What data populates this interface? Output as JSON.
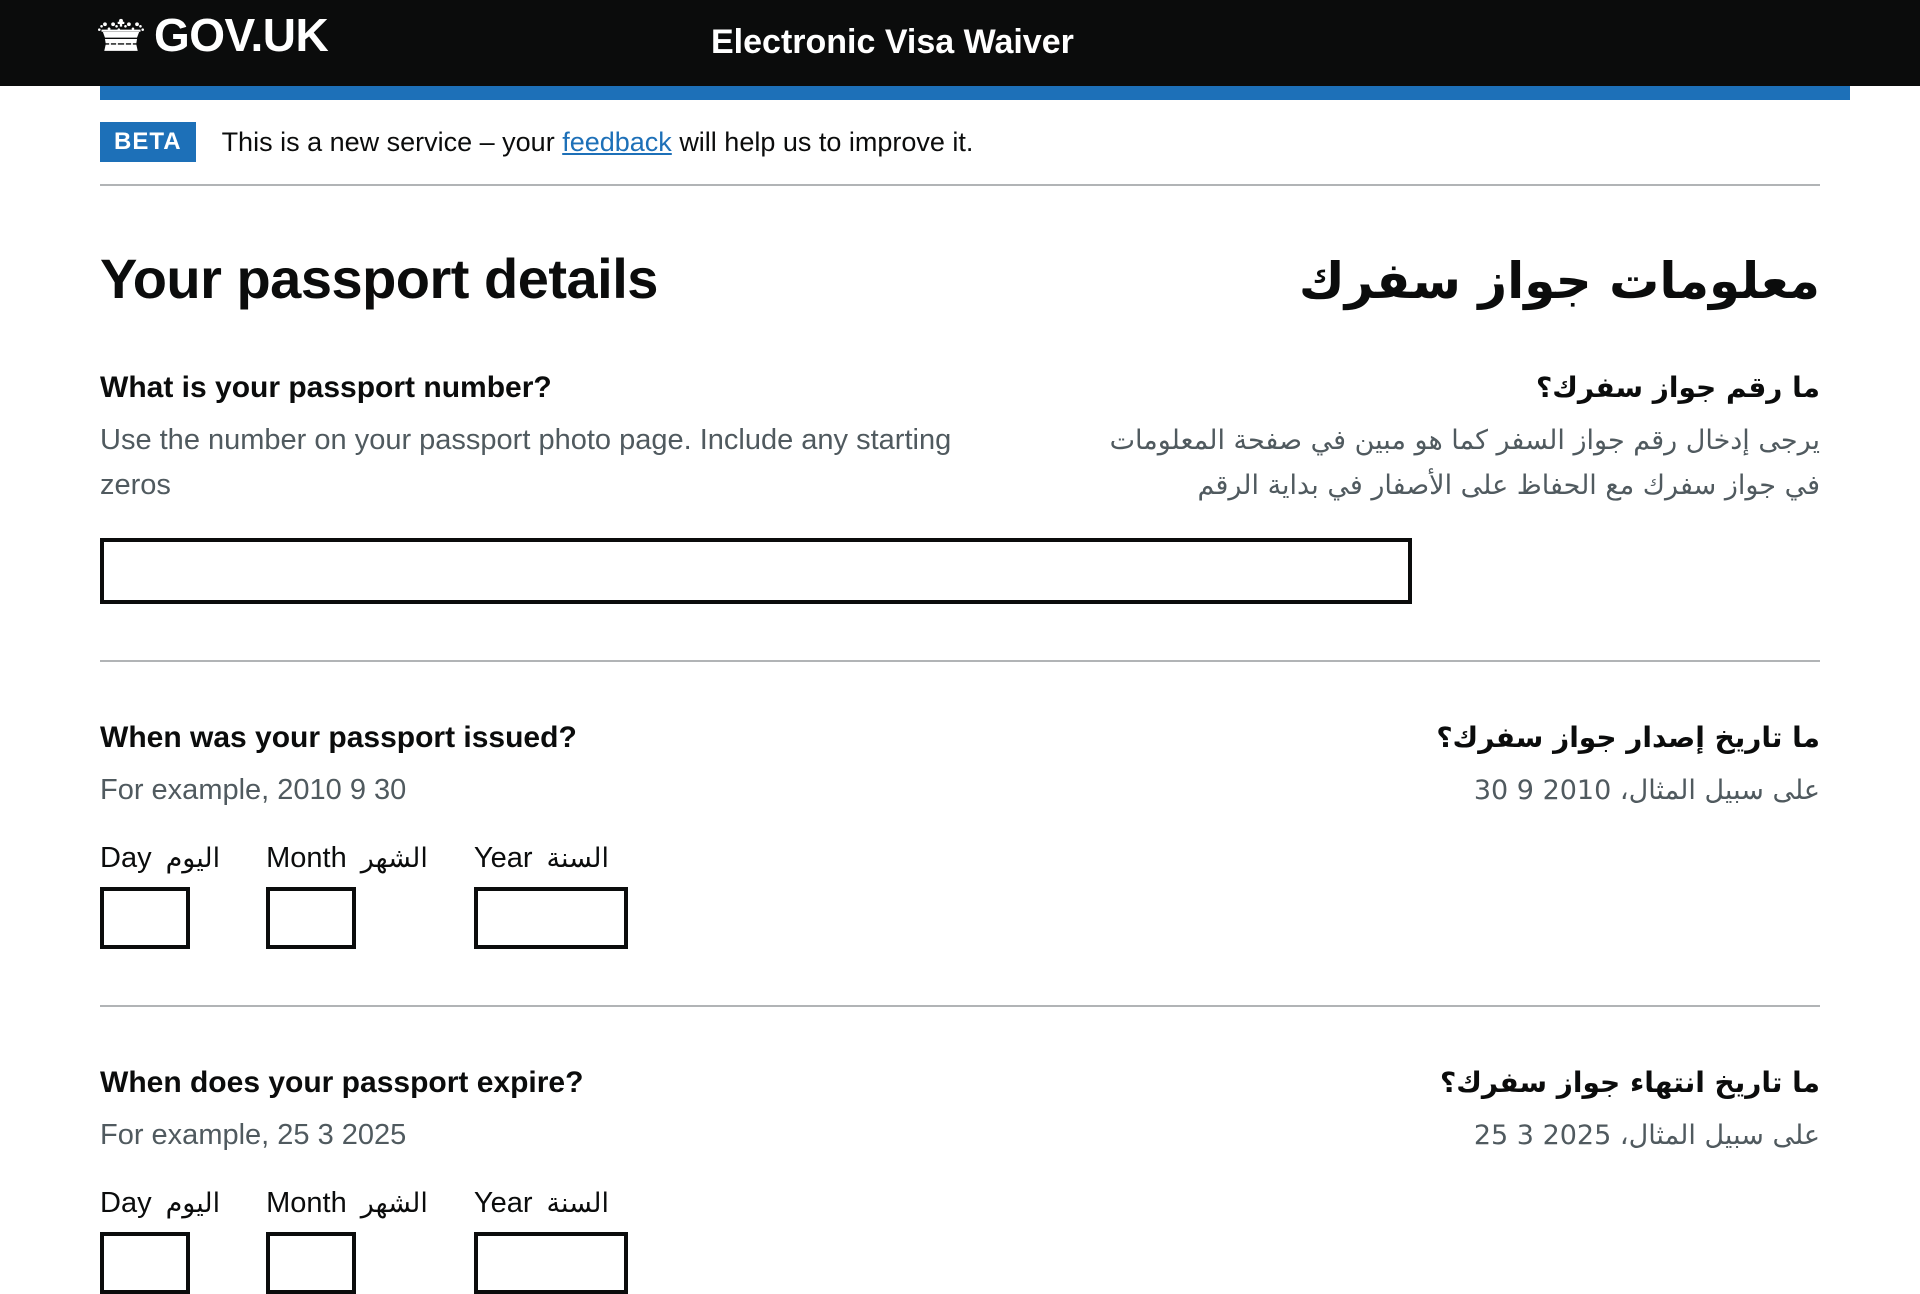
{
  "header": {
    "logo_text": "GOV.UK",
    "logo_icon": "crown-icon",
    "service_name": "Electronic Visa Waiver"
  },
  "phase_banner": {
    "tag": "BETA",
    "text_before": "This is a new service – your",
    "link_text": "feedback",
    "text_after": "will help us to improve it."
  },
  "page": {
    "title_en": "Your passport details",
    "title_ar": "معلومات جواز سفرك"
  },
  "questions": [
    {
      "id": "passport-number",
      "label_en": "What is your passport number?",
      "label_ar": "ما رقم جواز سفرك؟",
      "hint_en": "Use the number on your passport photo page. Include any starting zeros",
      "hint_ar": "يرجى إدخال رقم جواز السفر كما هو مبين في صفحة المعلومات في جواز سفرك مع الحفاظ على الأصفار في بداية الرقم",
      "value": "",
      "placeholder": ""
    },
    {
      "id": "passport-issued",
      "label_en": "When was your passport issued?",
      "label_ar": "ما تاريخ إصدار جواز سفرك؟",
      "hint_en": "For example, 2010 9 30",
      "hint_ar": "على سبيل المثال، 2010 9 30",
      "day": {
        "label_en": "Day",
        "label_ar": "اليوم",
        "value": ""
      },
      "month": {
        "label_en": "Month",
        "label_ar": "الشهر",
        "value": ""
      },
      "year": {
        "label_en": "Year",
        "label_ar": "السنة",
        "value": ""
      }
    },
    {
      "id": "passport-expire",
      "label_en": "When does your passport expire?",
      "label_ar": "ما تاريخ انتهاء جواز سفرك؟",
      "hint_en": "For example, 25 3 2025",
      "hint_ar": "على سبيل المثال، 2025 3 25",
      "day": {
        "label_en": "Day",
        "label_ar": "اليوم",
        "value": ""
      },
      "month": {
        "label_en": "Month",
        "label_ar": "الشهر",
        "value": ""
      },
      "year": {
        "label_en": "Year",
        "label_ar": "السنة",
        "value": ""
      }
    }
  ],
  "colors": {
    "header_bg": "#0b0c0c",
    "accent_blue": "#1d70b8",
    "text": "#0b0c0c",
    "hint_text": "#505a5f",
    "border_grey": "#b1b4b6"
  }
}
